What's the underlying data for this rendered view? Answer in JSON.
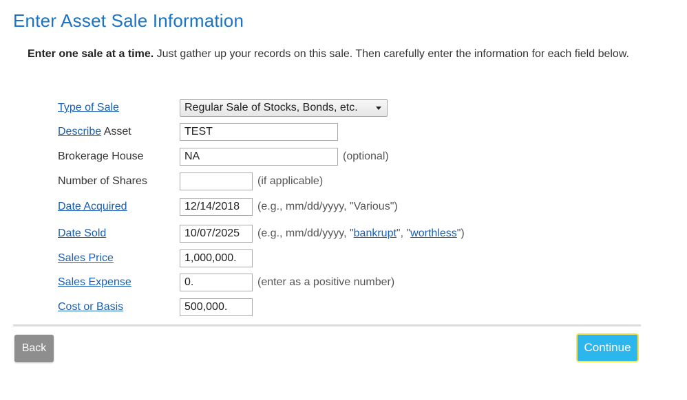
{
  "page": {
    "title": "Enter Asset Sale Information"
  },
  "intro": {
    "bold": "Enter one sale at a time.",
    "text": " Just gather up your records on this sale. Then carefully enter the information for each field below."
  },
  "form": {
    "type_of_sale": {
      "label": "Type of Sale",
      "value": "Regular Sale of Stocks, Bonds, etc."
    },
    "describe_asset": {
      "label_link": "Describe",
      "label_rest": " Asset",
      "value": "TEST"
    },
    "brokerage_house": {
      "label": "Brokerage House",
      "value": "NA",
      "hint": "(optional)"
    },
    "number_of_shares": {
      "label": "Number of Shares",
      "value": "",
      "hint": "(if applicable)"
    },
    "date_acquired": {
      "label": "Date Acquired",
      "value": "12/14/2018",
      "hint": "(e.g., mm/dd/yyyy, \"Various\")"
    },
    "date_sold": {
      "label": "Date Sold",
      "value": "10/07/2025",
      "hint_prefix": "(e.g., mm/dd/yyyy, \"",
      "hint_link_1": "bankrupt",
      "hint_mid": "\", \"",
      "hint_link_2": "worthless",
      "hint_suffix": "\")"
    },
    "sales_price": {
      "label": "Sales Price",
      "value": "1,000,000."
    },
    "sales_expense": {
      "label": "Sales Expense",
      "value": "0.",
      "hint": "(enter as a positive number)"
    },
    "cost_or_basis": {
      "label": "Cost or Basis",
      "value": "500,000."
    }
  },
  "buttons": {
    "back": "Back",
    "continue": "Continue"
  },
  "colors": {
    "title": "#1a73c4",
    "link": "#1a5fb4",
    "continue_bg": "#2bb6ee",
    "continue_border": "#f4e64c",
    "back_bg": "#8e8e8e"
  }
}
